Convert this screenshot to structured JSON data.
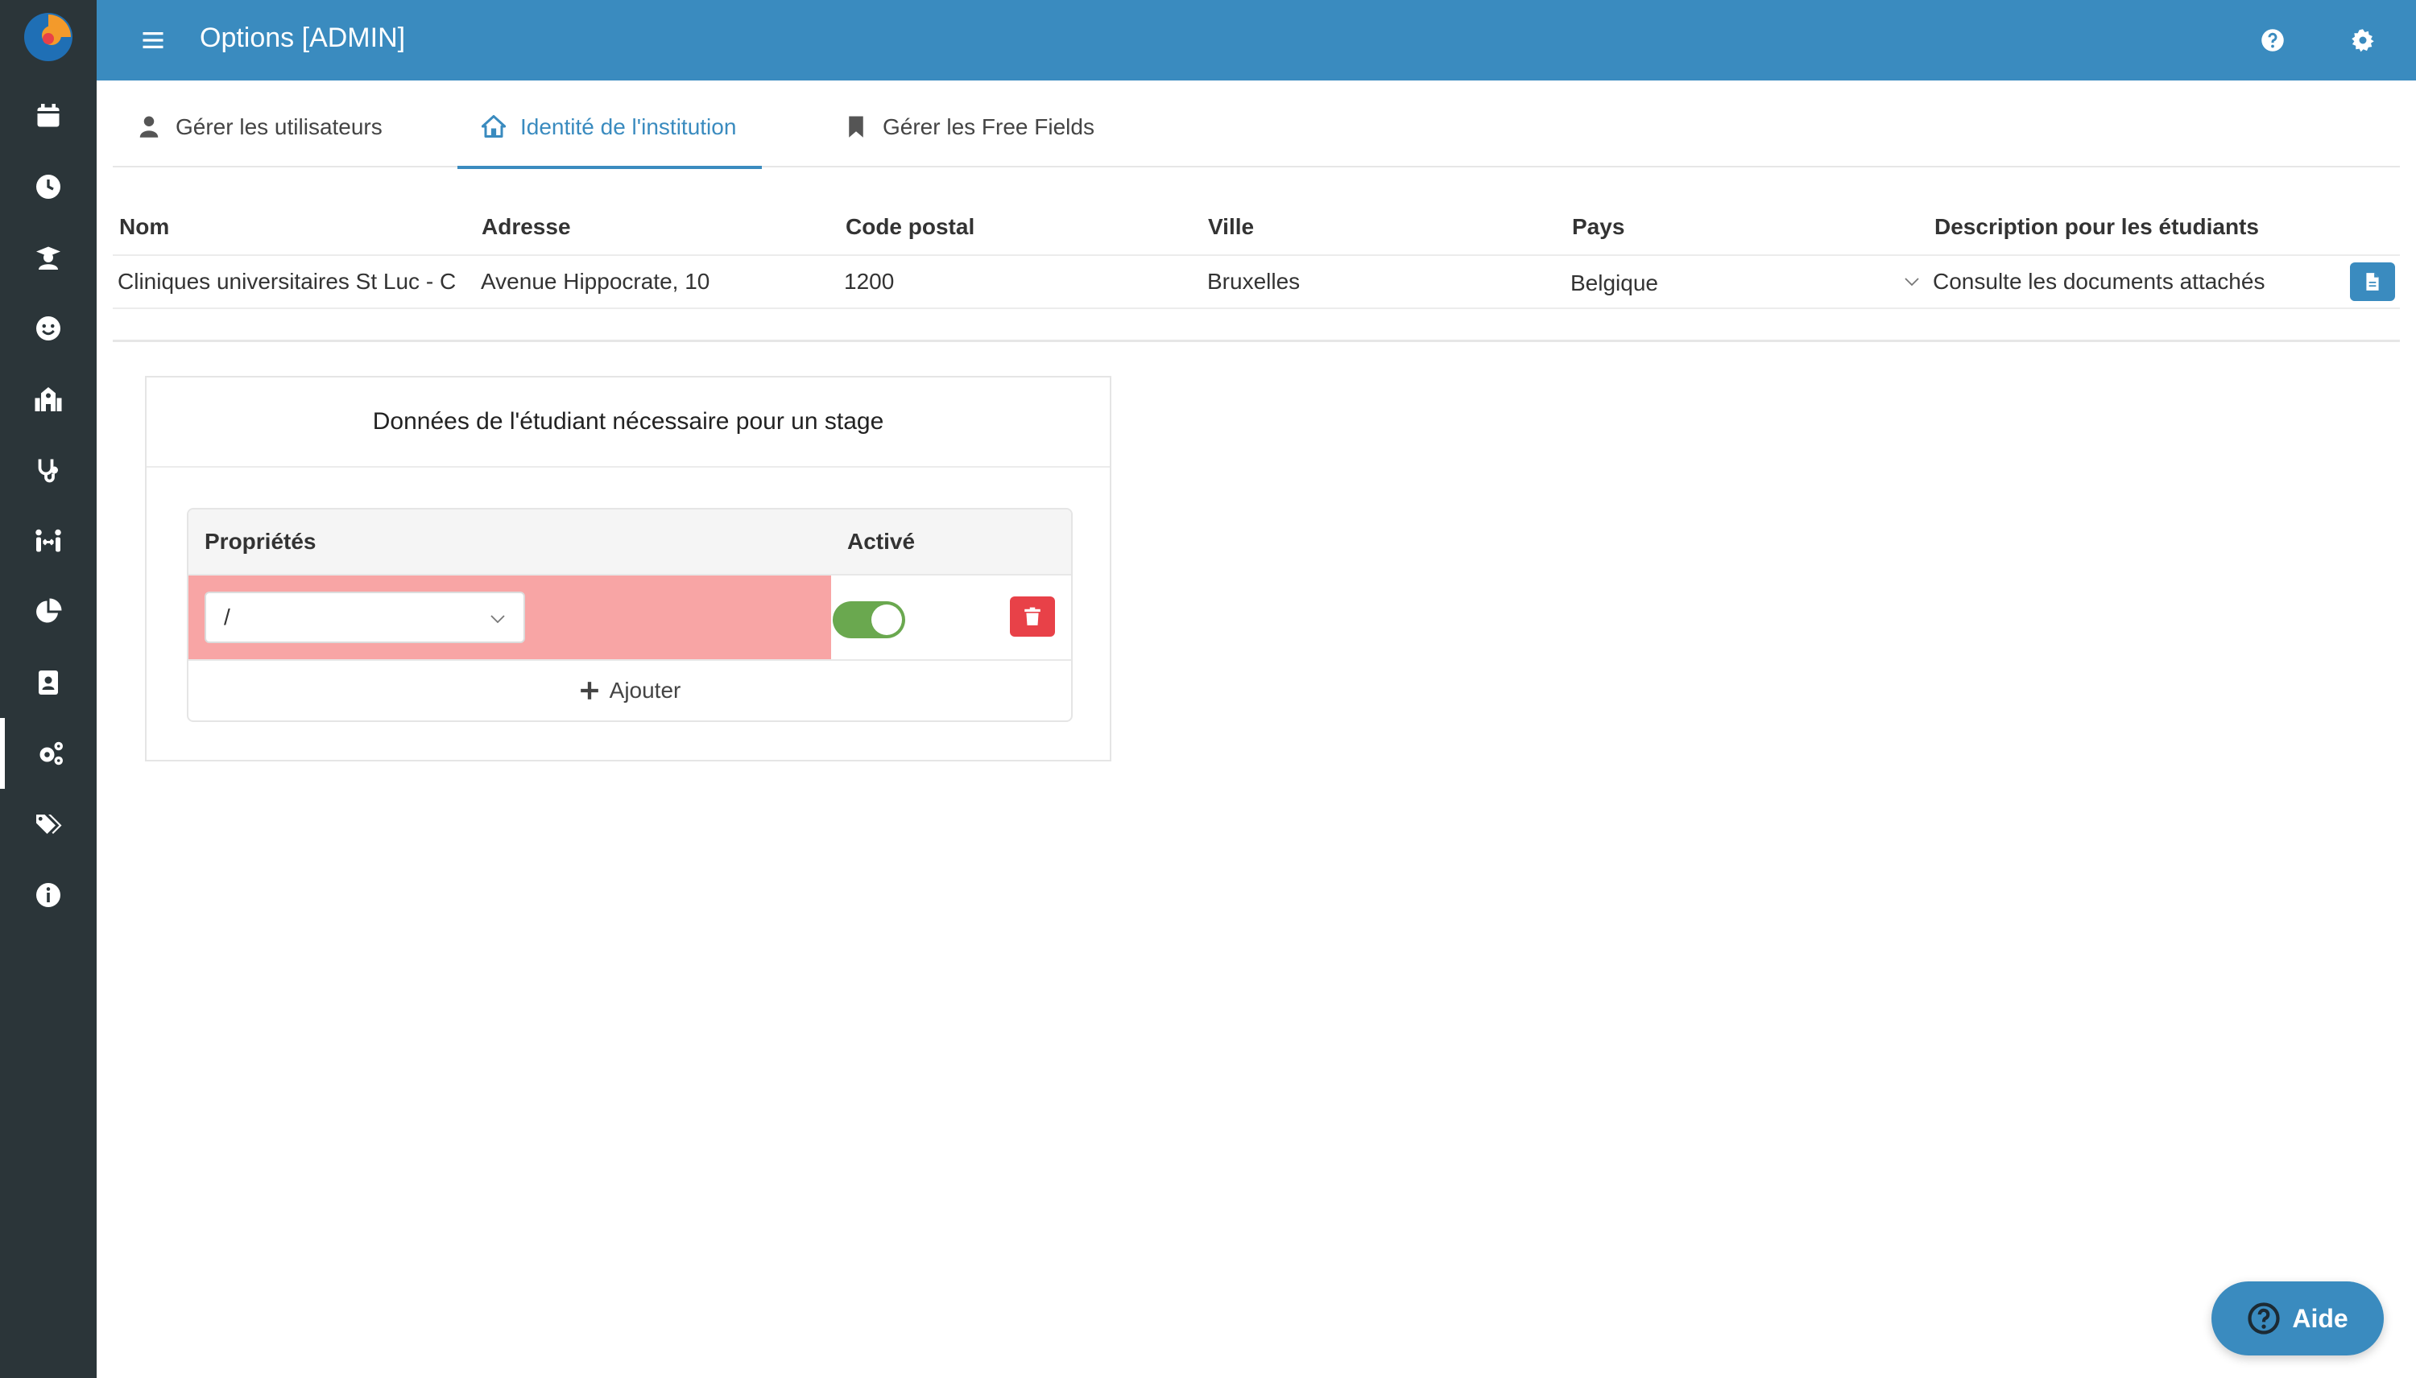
{
  "app": {
    "title": "Options [ADMIN]"
  },
  "sidebar": {
    "items": [
      {
        "icon": "calendar-icon"
      },
      {
        "icon": "clock-icon"
      },
      {
        "icon": "graduate-icon"
      },
      {
        "icon": "smile-icon"
      },
      {
        "icon": "school-icon"
      },
      {
        "icon": "stethoscope-icon"
      },
      {
        "icon": "people-arrows-icon"
      },
      {
        "icon": "pie-chart-icon"
      },
      {
        "icon": "id-card-icon"
      },
      {
        "icon": "cogs-icon",
        "active": true
      },
      {
        "icon": "tags-icon"
      },
      {
        "icon": "info-icon"
      }
    ]
  },
  "tabs": [
    {
      "label": "Gérer les utilisateurs",
      "icon": "user-icon"
    },
    {
      "label": "Identité de l'institution",
      "icon": "home-icon",
      "active": true
    },
    {
      "label": "Gérer les Free Fields",
      "icon": "bookmark-icon"
    }
  ],
  "institution": {
    "headers": {
      "nom": "Nom",
      "adresse": "Adresse",
      "code_postal": "Code postal",
      "ville": "Ville",
      "pays": "Pays",
      "description": "Description pour les étudiants"
    },
    "row": {
      "nom": "Cliniques universitaires St Luc - Ce",
      "adresse": "Avenue Hippocrate, 10",
      "code_postal": "1200",
      "ville": "Bruxelles",
      "pays": "Belgique",
      "description": "Consulte les documents attachés"
    }
  },
  "student_data": {
    "title": "Données de l'étudiant nécessaire pour un stage",
    "headers": {
      "proprietes": "Propriétés",
      "active": "Activé"
    },
    "rows": [
      {
        "property": "/",
        "enabled": true
      }
    ],
    "add_label": "Ajouter"
  },
  "help": {
    "label": "Aide"
  },
  "colors": {
    "primary": "#3a8bbf",
    "sidebar": "#2b3539",
    "error_row": "#f8a5a5",
    "toggle_on": "#6aa84f",
    "danger": "#e84148"
  }
}
